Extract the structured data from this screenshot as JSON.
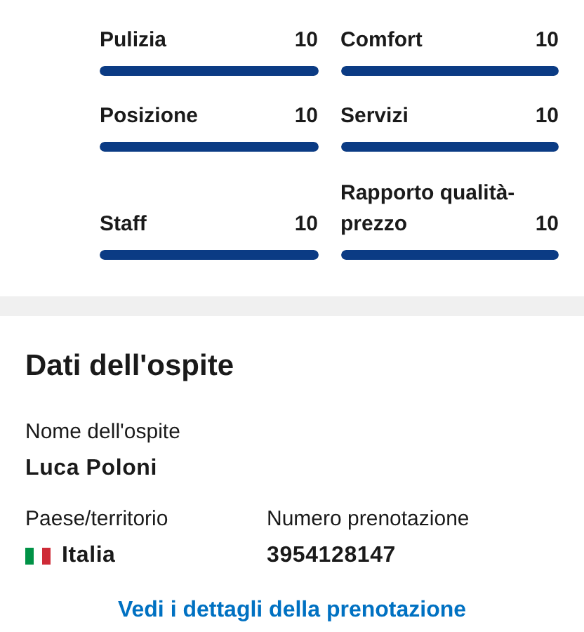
{
  "rating_rows": [
    [
      {
        "label": "Pulizia",
        "score": "10",
        "level": 1
      },
      {
        "label": "Comfort",
        "score": "10",
        "level": 1
      }
    ],
    [
      {
        "label": "Posizione",
        "score": "10",
        "level": 1
      },
      {
        "label": "Servizi",
        "score": "10",
        "level": 1
      }
    ],
    [
      {
        "label": "Staff",
        "score": "10",
        "level": 1
      },
      {
        "label": "Rapporto qualità-prezzo",
        "score": "10",
        "level": 1
      }
    ]
  ],
  "guest": {
    "title": "Dati dell'ospite",
    "fields": [
      {
        "label": "Nome dell'ospite",
        "value": "Luca Poloni",
        "kind": "text"
      },
      {
        "label": "Paese/territorio",
        "value": "Italia",
        "kind": "country"
      },
      {
        "label": "Numero prenotazione",
        "value": "3954128147",
        "kind": "text"
      }
    ],
    "link": "Vedi i dettagli della prenotazione"
  }
}
